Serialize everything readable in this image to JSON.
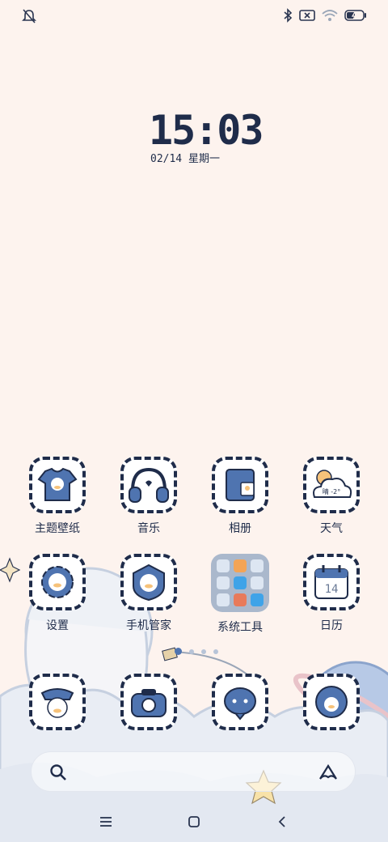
{
  "status": {
    "left_icons": [
      "bell-off-icon"
    ],
    "right_icons": [
      "bluetooth-icon",
      "no-sim-icon",
      "wifi-icon",
      "battery-charging-icon"
    ]
  },
  "lockclock": {
    "time": "15:03",
    "date": "02/14 星期一"
  },
  "apps": [
    {
      "label": "主题壁纸",
      "icon": "tshirt-duck-icon"
    },
    {
      "label": "音乐",
      "icon": "headphones-icon"
    },
    {
      "label": "相册",
      "icon": "photo-album-icon"
    },
    {
      "label": "天气",
      "icon": "weather-cloud-icon"
    },
    {
      "label": "设置",
      "icon": "gear-duck-icon"
    },
    {
      "label": "手机管家",
      "icon": "security-shield-duck-icon"
    },
    {
      "label": "系统工具",
      "icon": "folder-icon"
    },
    {
      "label": "日历",
      "icon": "calendar-icon"
    }
  ],
  "weather_icon_text": "晴 -2°",
  "calendar_icon_text": "14",
  "dock_apps": [
    {
      "icon": "phone-duck-icon"
    },
    {
      "icon": "camera-icon"
    },
    {
      "icon": "messages-icon"
    },
    {
      "icon": "browser-globe-icon"
    }
  ],
  "page_indicator": {
    "pages": 4,
    "current": 1
  },
  "search": {
    "icons": [
      "search-icon",
      "assistant-icon"
    ]
  },
  "nav": {
    "buttons": [
      "menu-icon",
      "home-icon",
      "back-icon"
    ]
  },
  "colors": {
    "background": "#fdf3ee",
    "ink": "#1f2c4a",
    "accent": "#4f74b0"
  }
}
